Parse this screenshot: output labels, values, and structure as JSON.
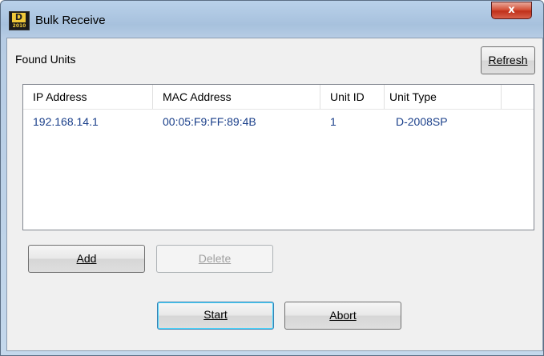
{
  "window": {
    "title": "Bulk Receive",
    "close_glyph": "x",
    "app_icon": {
      "top": "D",
      "bottom": "2010"
    }
  },
  "found_units_label": "Found Units",
  "buttons": {
    "refresh": {
      "label": "Refresh"
    },
    "add": {
      "label": "Add"
    },
    "delete": {
      "label": "Delete",
      "enabled": false
    },
    "start": {
      "label": "Start",
      "default": true
    },
    "abort": {
      "label": "Abort"
    }
  },
  "table": {
    "columns": [
      "IP Address",
      "MAC Address",
      "Unit ID",
      "Unit Type"
    ],
    "rows": [
      {
        "ip": "192.168.14.1",
        "mac": "00:05:F9:FF:89:4B",
        "unit_id": "1",
        "unit_type": "D-2008SP"
      }
    ]
  },
  "colors": {
    "cell_text": "#1a3f8a",
    "title_bar": "#b9d1ea",
    "close_button": "#c0301a"
  }
}
